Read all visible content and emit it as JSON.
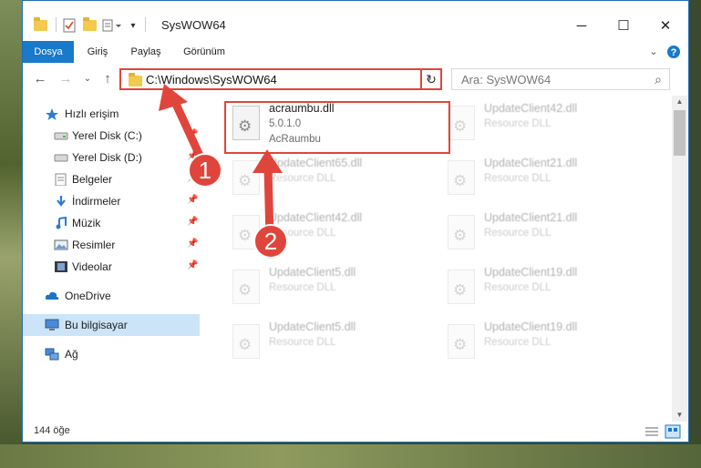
{
  "window": {
    "title": "SysWOW64"
  },
  "ribbon": {
    "tabs": [
      "Dosya",
      "Giriş",
      "Paylaş",
      "Görünüm"
    ]
  },
  "address": {
    "path": "C:\\Windows\\SysWOW64",
    "search_placeholder": "Ara: SysWOW64"
  },
  "sidebar": {
    "items": [
      {
        "label": "Hızlı erişim",
        "icon": "star-icon"
      },
      {
        "label": "Yerel Disk (C:)",
        "icon": "drive-icon"
      },
      {
        "label": "Yerel Disk (D:)",
        "icon": "drive-icon"
      },
      {
        "label": "Belgeler",
        "icon": "documents-icon"
      },
      {
        "label": "İndirmeler",
        "icon": "download-icon"
      },
      {
        "label": "Müzik",
        "icon": "music-icon"
      },
      {
        "label": "Resimler",
        "icon": "pictures-icon"
      },
      {
        "label": "Videolar",
        "icon": "videos-icon"
      },
      {
        "label": "OneDrive",
        "icon": "cloud-icon"
      },
      {
        "label": "Bu bilgisayar",
        "icon": "computer-icon"
      },
      {
        "label": "Ağ",
        "icon": "network-icon"
      }
    ]
  },
  "files": [
    {
      "name": "acraumbu.dll",
      "line1": "5.0.1.0",
      "line2": "AcRaumbu",
      "highlighted": true
    },
    {
      "name": "UpdateClient42.dll",
      "line1": "Resource DLL"
    },
    {
      "name": "UpdateClient65.dll",
      "line1": "Resource DLL"
    },
    {
      "name": "UpdateClient21.dll",
      "line1": "Resource DLL"
    },
    {
      "name": "UpdateClient42.dll",
      "line1": "Resource DLL"
    },
    {
      "name": "UpdateClient21.dll",
      "line1": "Resource DLL"
    },
    {
      "name": "UpdateClient5.dll",
      "line1": "Resource DLL"
    },
    {
      "name": "UpdateClient19.dll",
      "line1": "Resource DLL"
    },
    {
      "name": "UpdateClient5.dll",
      "line1": "Resource DLL"
    },
    {
      "name": "UpdateClient19.dll",
      "line1": "Resource DLL"
    }
  ],
  "status": {
    "count": "144 öğe"
  },
  "annotations": {
    "badge1": "1",
    "badge2": "2"
  },
  "colors": {
    "accent": "#1979ca",
    "highlight": "#e0453b",
    "selection": "#cce4f7"
  }
}
